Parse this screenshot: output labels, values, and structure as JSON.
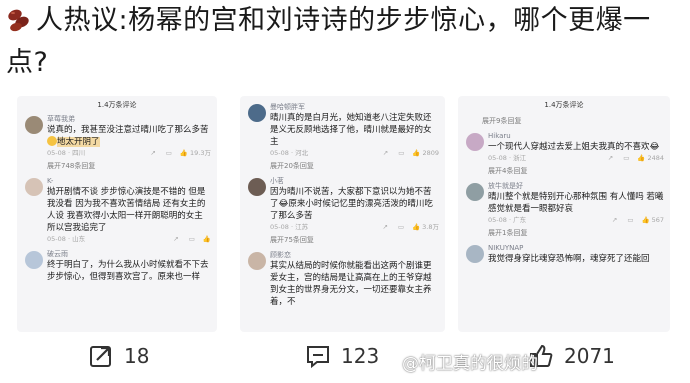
{
  "post": {
    "title": "人热议:杨幂的宫和刘诗诗的步步惊心，哪个更爆一点?"
  },
  "panels": [
    {
      "header": "1.4万条评论",
      "comments": [
        {
          "name": "草莓我弟",
          "text": "说真的，我甚至没注意过晴川吃了那么多苦",
          "text2": "地太开阴了",
          "meta_date": "05-08 · 四川",
          "likes": "19.3万",
          "expand": "展开748条回复"
        },
        {
          "name": "K-",
          "text": "抛开剧情不谈 步步惊心演技是不错的 但是我没看 因为我不喜欢苦情结局 还有女主的人设 我喜欢得小太阳一样开朗聪明的女主 所以宫我追完了",
          "meta_date": "05-08 · 山东",
          "likes": "",
          "expand": ""
        },
        {
          "name": "破云雨",
          "text": "终于明白了，为什么我从小时候就看不下去步步惊心，但得到喜欢宫了。原来也一样",
          "meta_date": "",
          "likes": "",
          "expand": ""
        }
      ]
    },
    {
      "header": "",
      "comments": [
        {
          "name": "曼哈顿胖军",
          "text": "晴川真的是白月光，她知道老八注定失败还是义无反顾地选择了他，晴川就是最好的女主",
          "meta_date": "05-08 · 河北",
          "likes": "2809",
          "expand": "展开20条回复"
        },
        {
          "name": "小茗",
          "text": "因为晴川不说苦，大家都下意识以为她不苦了😂原来小时候记忆里的漂亮活泼的晴川吃了那么多苦",
          "meta_date": "05-08 · 江苏",
          "likes": "3.8万",
          "expand": "展开75条回复"
        },
        {
          "name": "顾影恋",
          "text": "其实从结局的时候你就能看出这两个剧谁更爱女主，宫的结局是让高高在上的王爷穿越到女主的世界身无分文，一切还要靠女主养着，不",
          "meta_date": "",
          "likes": "",
          "expand": ""
        }
      ]
    },
    {
      "header": "1.4万条评论",
      "comments": [
        {
          "name": "",
          "text": "",
          "meta_date": "",
          "likes": "",
          "expand": "展开9条回复"
        },
        {
          "name": "Hikaru",
          "text": "一个现代人穿越过去爱上姐夫我真的不喜欢😂",
          "meta_date": "05-08 · 浙江",
          "likes": "2484",
          "expand": "展开4条回复"
        },
        {
          "name": "放牛就是好",
          "text": "晴川整个就是特别开心那种氛围 有人懂吗 若曦感觉就是看一眼都好哀",
          "meta_date": "05-08 · 广东",
          "likes": "567",
          "expand": "展开1条回复"
        },
        {
          "name": "NIKUYNAP",
          "text": "我觉得身穿比魂穿恐怖啊，魂穿死了还能回",
          "meta_date": "",
          "likes": "",
          "expand": ""
        }
      ]
    }
  ],
  "actions": {
    "share_count": "18",
    "comment_count": "123",
    "like_count": "2071"
  },
  "watermark": "@柯卫真的很烦的",
  "colors": {
    "highlight": "#f3d9a3",
    "bean": "#8b2a1f"
  }
}
